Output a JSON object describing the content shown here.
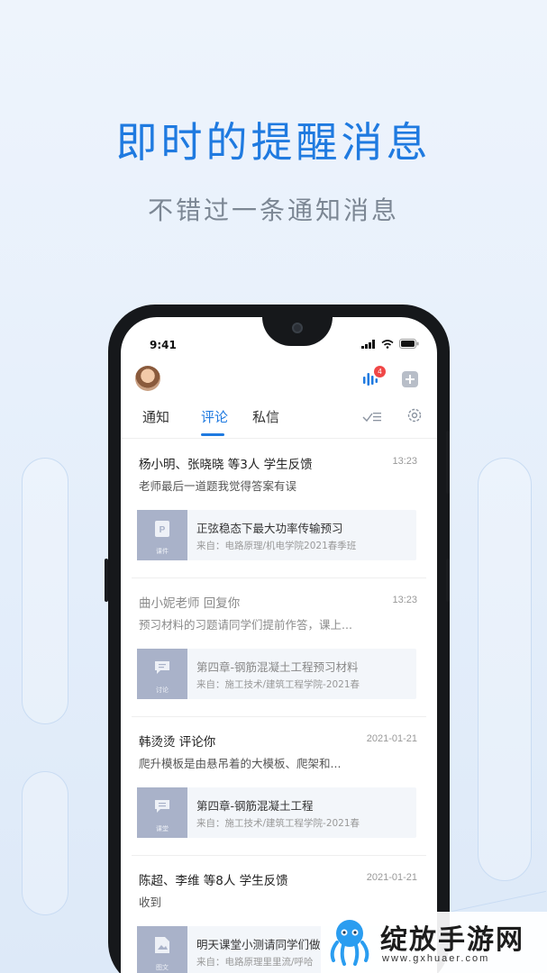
{
  "promo": {
    "headline": "即时的提醒消息",
    "subline": "不错过一条通知消息"
  },
  "status_bar": {
    "time": "9:41"
  },
  "header": {
    "badge_count": "4"
  },
  "tabs": [
    {
      "label": "通知"
    },
    {
      "label": "评论"
    },
    {
      "label": "私信"
    }
  ],
  "feed": [
    {
      "title": "杨小明、张晓晓 等3人 学生反馈",
      "time": "13:23",
      "body": "老师最后一道题我觉得答案有误",
      "card": {
        "thumb_label": "课件",
        "title": "正弦稳态下最大功率传输预习",
        "sub": "来自：电路原理/机电学院2021春季班"
      }
    },
    {
      "title": "曲小妮老师 回复你",
      "time": "13:23",
      "body": "预习材料的习题请同学们提前作答，课上...",
      "card": {
        "thumb_label": "讨论",
        "title": "第四章-钢筋混凝土工程预习材料",
        "sub": "来自：施工技术/建筑工程学院-2021春"
      }
    },
    {
      "title": "韩烫烫 评论你",
      "time": "2021-01-21",
      "body": "爬升模板是由悬吊着的大模板、爬架和...",
      "card": {
        "thumb_label": "课堂",
        "title": "第四章-钢筋混凝土工程",
        "sub": "来自：施工技术/建筑工程学院-2021春"
      }
    },
    {
      "title": "陈超、李维 等8人 学生反馈",
      "time": "2021-01-21",
      "body": "收到",
      "card": {
        "thumb_label": "图文",
        "title": "明天课堂小测请同学们做",
        "sub": "来自：电路原理里里流/呼哈"
      }
    }
  ],
  "watermark": {
    "text": "绽放手游网",
    "url": "www.gxhuaer.com"
  },
  "colors": {
    "accent": "#1f7ae0",
    "badge": "#f04747"
  }
}
